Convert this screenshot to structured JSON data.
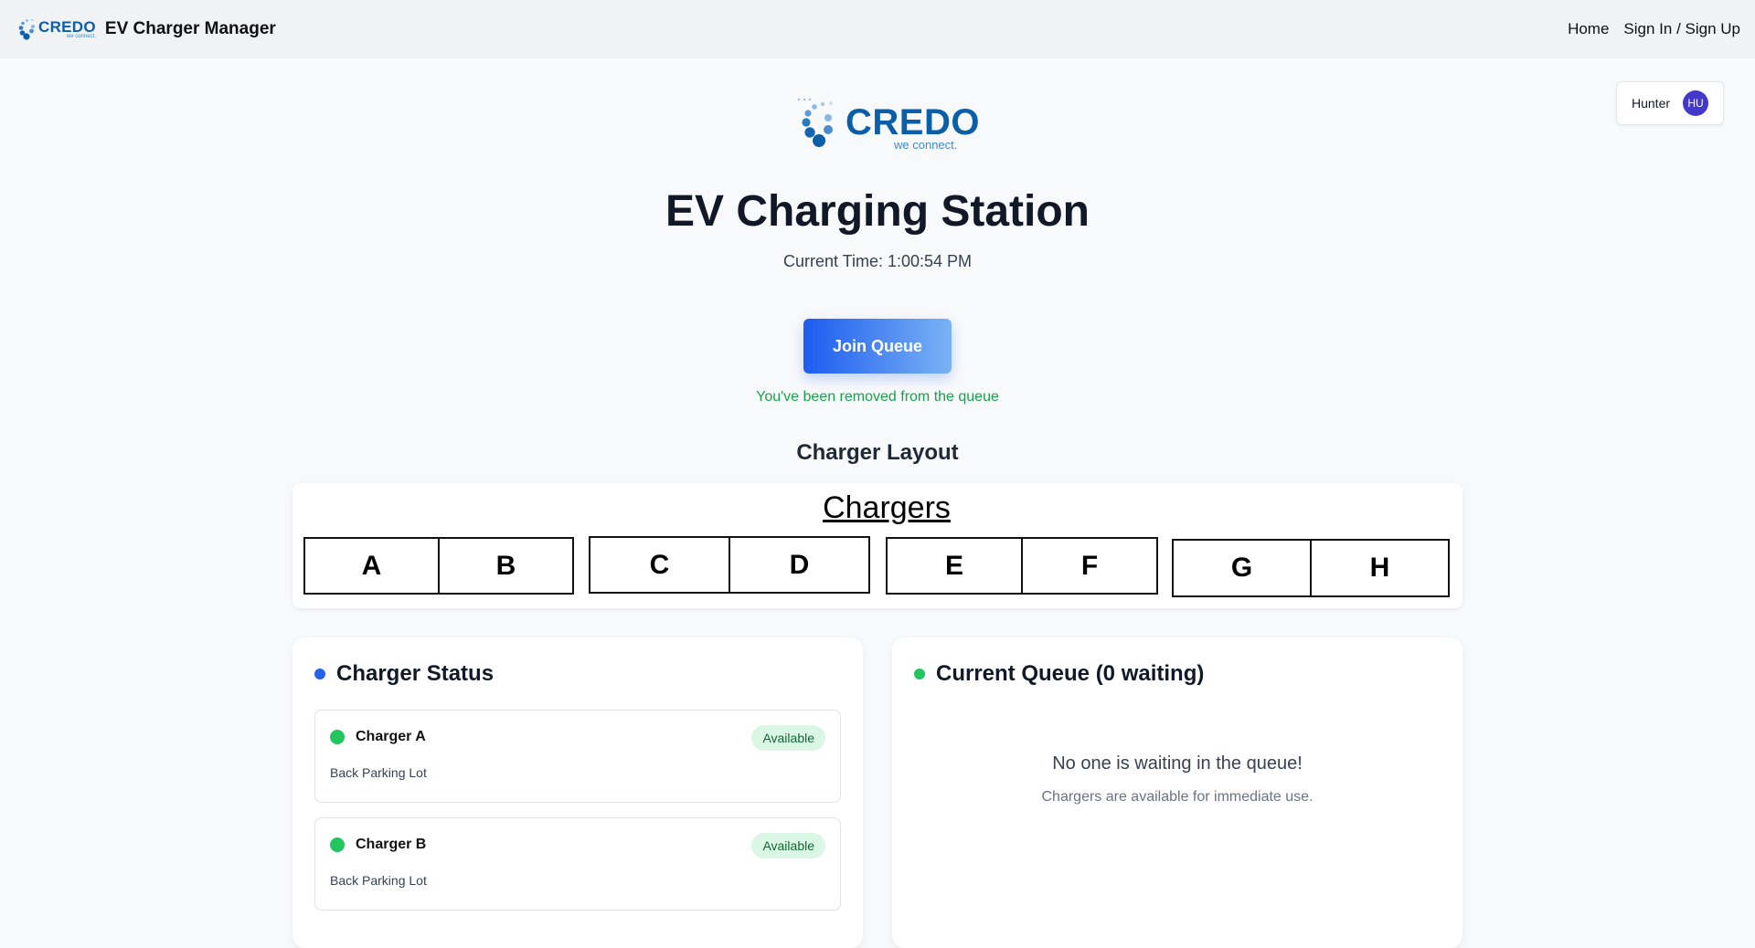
{
  "nav": {
    "logo_text": "CREDO",
    "logo_tagline": "we connect.",
    "app_title": "EV Charger Manager",
    "links": [
      "Home",
      "Sign In / Sign Up"
    ]
  },
  "user": {
    "name": "Hunter",
    "initials": "HU",
    "avatar_color": "#4338ca"
  },
  "hero": {
    "logo_text": "CREDO",
    "logo_tagline": "we connect.",
    "title": "EV Charging Station",
    "current_time": "Current Time: 1:00:54 PM",
    "join_button": "Join Queue",
    "message": "You've been removed from the queue"
  },
  "layout": {
    "heading": "Charger Layout",
    "title": "Chargers",
    "pairs": [
      [
        "A",
        "B"
      ],
      [
        "C",
        "D"
      ],
      [
        "E",
        "F"
      ],
      [
        "G",
        "H"
      ]
    ]
  },
  "status": {
    "heading": "Charger Status",
    "accent": "#2563eb",
    "chargers": [
      {
        "name": "Charger A",
        "badge": "Available",
        "location": "Back Parking Lot"
      },
      {
        "name": "Charger B",
        "badge": "Available",
        "location": "Back Parking Lot"
      }
    ]
  },
  "queue": {
    "heading": "Current Queue (0 waiting)",
    "accent": "#16a34a",
    "empty_title": "No one is waiting in the queue!",
    "empty_subtitle": "Chargers are available for immediate use."
  },
  "colors": {
    "brand": "#0b5ea8",
    "success": "#22c55e",
    "primary_gradient_start": "#1d5cf0",
    "primary_gradient_end": "#7ab2f4"
  }
}
